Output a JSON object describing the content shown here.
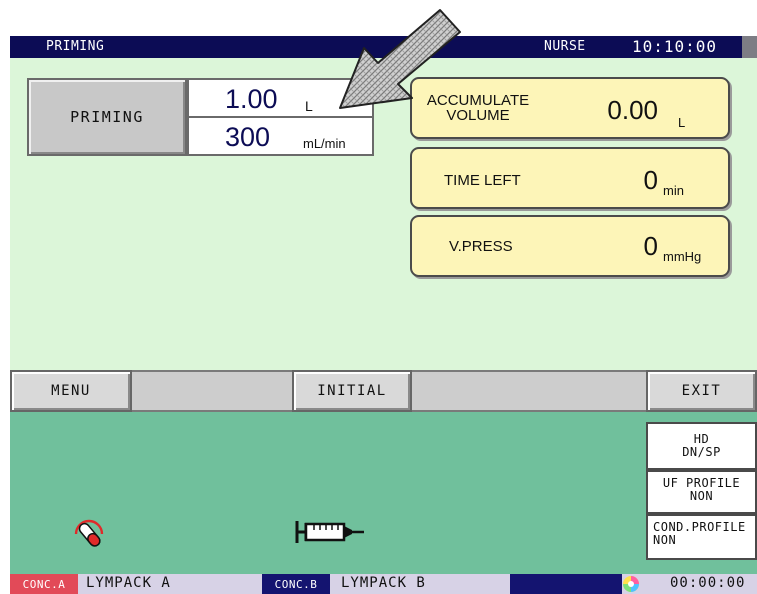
{
  "header": {
    "title": "PRIMING",
    "user": "NURSE",
    "time": "10:10:00"
  },
  "priming": {
    "button_label": "PRIMING",
    "volume_value": "1.00",
    "volume_unit": "L",
    "rate_value": "300",
    "rate_unit": "mL/min"
  },
  "panels": {
    "accumulate": {
      "label_line1": "ACCUMULATE",
      "label_line2": "VOLUME",
      "value": "0.00",
      "unit": "L"
    },
    "time_left": {
      "label": "TIME LEFT",
      "value": "0",
      "unit": "min"
    },
    "v_press": {
      "label": "V.PRESS",
      "value": "0",
      "unit": "mmHg"
    }
  },
  "menu": {
    "menu_label": "MENU",
    "initial_label": "INITIAL",
    "exit_label": "EXIT"
  },
  "modes": {
    "hd_line1": "HD",
    "hd_line2": "DN/SP",
    "uf_line1": "UF PROFILE",
    "uf_line2": "NON",
    "cond_line1": "COND.PROFILE",
    "cond_line2": "NON"
  },
  "status": {
    "conc_a_tag": "CONC.A",
    "conc_a_name": "LYMPACK A",
    "conc_b_tag": "CONC.B",
    "conc_b_name": "LYMPACK B",
    "elapsed": "00:00:00"
  },
  "icons": {
    "arrow": "pointer-arrow-icon",
    "gauge": "pressure-gauge-icon",
    "syringe": "syringe-icon",
    "color": "color-wheel-icon"
  },
  "colors": {
    "topbar": "#0c0c55",
    "main_bg": "#dcf6d9",
    "panel_bg": "#fdf5b8",
    "lower_bg": "#70c09c",
    "conc_a": "#e24a58",
    "conc_b": "#141470"
  }
}
